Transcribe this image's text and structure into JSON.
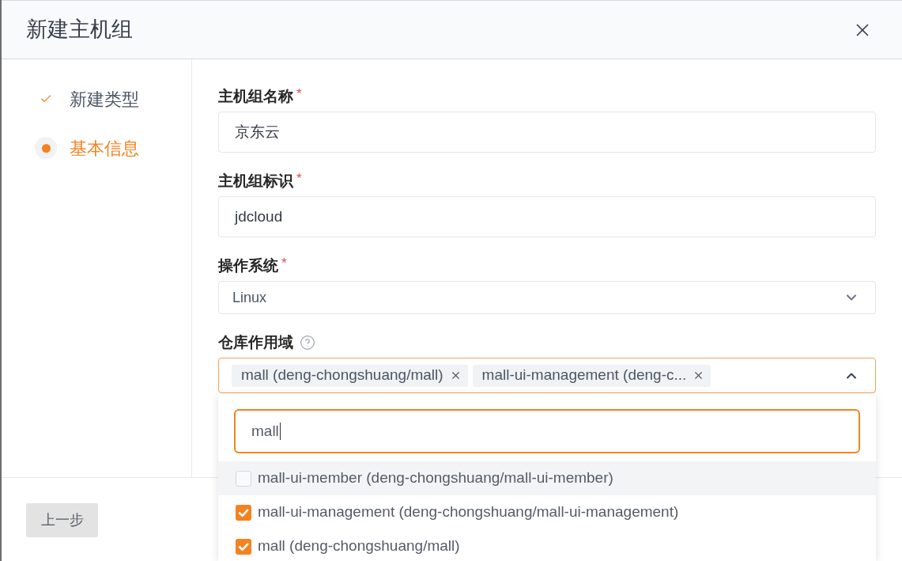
{
  "dialog": {
    "title": "新建主机组"
  },
  "steps": [
    {
      "label": "新建类型",
      "kind": "done",
      "selected": false
    },
    {
      "label": "基本信息",
      "kind": "current",
      "selected": true
    }
  ],
  "form": {
    "fields": [
      {
        "kind": "text",
        "label": "主机组名称",
        "required_mark": "*",
        "value": "京东云"
      },
      {
        "kind": "text",
        "label": "主机组标识",
        "required_mark": "*",
        "value": "jdcloud"
      },
      {
        "kind": "select",
        "label": "操作系统",
        "required_mark": "*",
        "value": "Linux",
        "expanded": false
      },
      {
        "kind": "multiselect",
        "label": "仓库作用域",
        "help": true,
        "expanded": true,
        "tags": [
          "mall (deng-chongshuang/mall)",
          "mall-ui-management (deng-c..."
        ],
        "dropdown": {
          "search_value": "mall",
          "options": [
            {
              "label": "mall-ui-member (deng-chongshuang/mall-ui-member)",
              "checked": false,
              "highlighted": true
            },
            {
              "label": "mall-ui-management (deng-chongshuang/mall-ui-management)",
              "checked": true,
              "highlighted": false
            },
            {
              "label": "mall (deng-chongshuang/mall)",
              "checked": true,
              "highlighted": false
            }
          ]
        }
      }
    ]
  },
  "footer": {
    "buttons": [
      {
        "label": "上一步"
      }
    ]
  }
}
